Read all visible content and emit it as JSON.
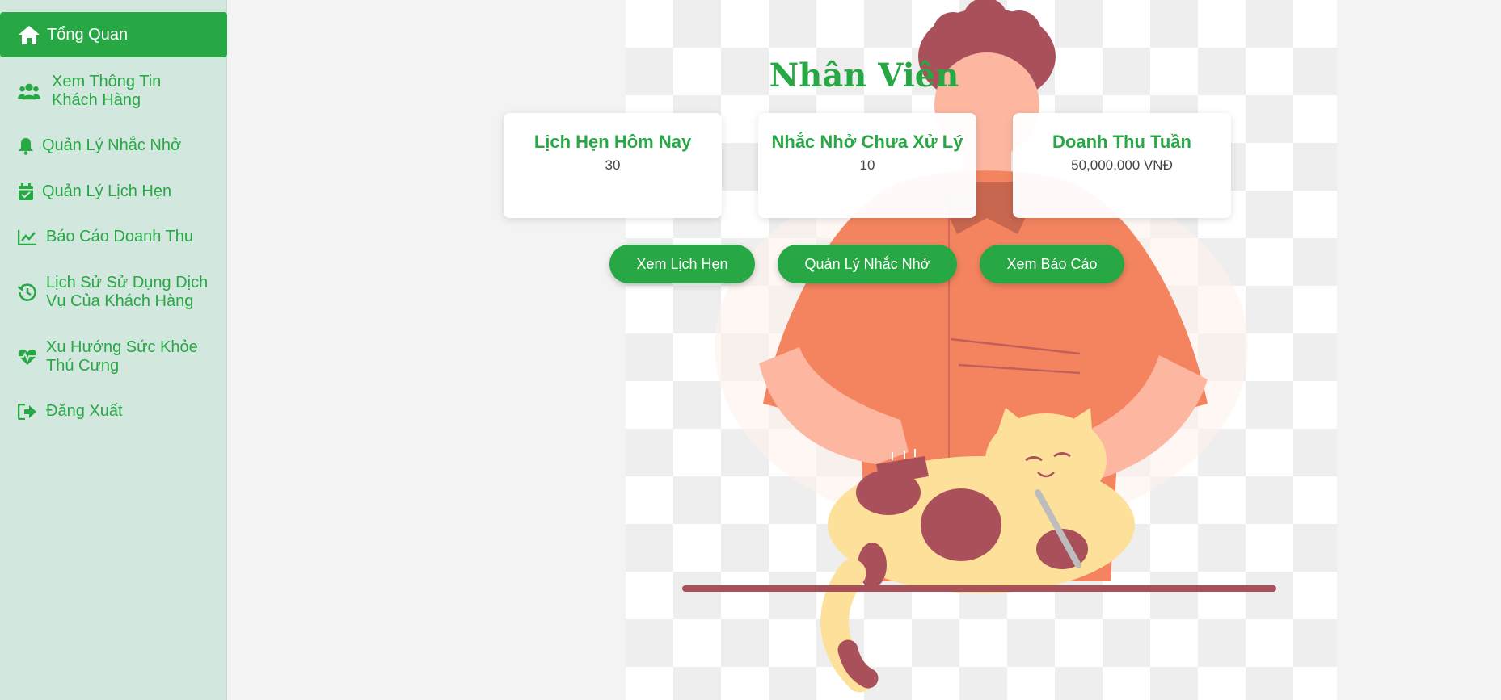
{
  "sidebar": {
    "items": [
      {
        "label": "Tổng Quan",
        "icon": "home-icon",
        "active": true
      },
      {
        "label": "Xem Thông Tin Khách Hàng",
        "icon": "users-icon"
      },
      {
        "label": "Quản Lý Nhắc Nhở",
        "icon": "bell-icon"
      },
      {
        "label": "Quản Lý Lịch Hẹn",
        "icon": "calendar-check-icon"
      },
      {
        "label": "Báo Cáo Doanh Thu",
        "icon": "chart-line-icon"
      },
      {
        "label": "Lịch Sử Sử Dụng Dịch Vụ Của Khách Hàng",
        "icon": "history-icon"
      },
      {
        "label": "Xu Hướng Sức Khỏe Thú Cưng",
        "icon": "heartbeat-icon"
      },
      {
        "label": "Đăng Xuất",
        "icon": "logout-icon"
      }
    ]
  },
  "main": {
    "title": "Nhân Viên",
    "cards": [
      {
        "title": "Lịch Hẹn Hôm Nay",
        "value": "30"
      },
      {
        "title": "Nhắc Nhở Chưa Xử Lý",
        "value": "10"
      },
      {
        "title": "Doanh Thu Tuần",
        "value": "50,000,000 VNĐ"
      }
    ],
    "buttons": [
      {
        "label": "Xem Lịch Hẹn"
      },
      {
        "label": "Quản Lý Nhắc Nhở"
      },
      {
        "label": "Xem Báo Cáo"
      }
    ]
  },
  "colors": {
    "accent": "#28a745",
    "sidebar_bg": "#d2e8df",
    "shirt": "#f4845f",
    "cat": "#fde19a",
    "spots": "#a9505a"
  }
}
